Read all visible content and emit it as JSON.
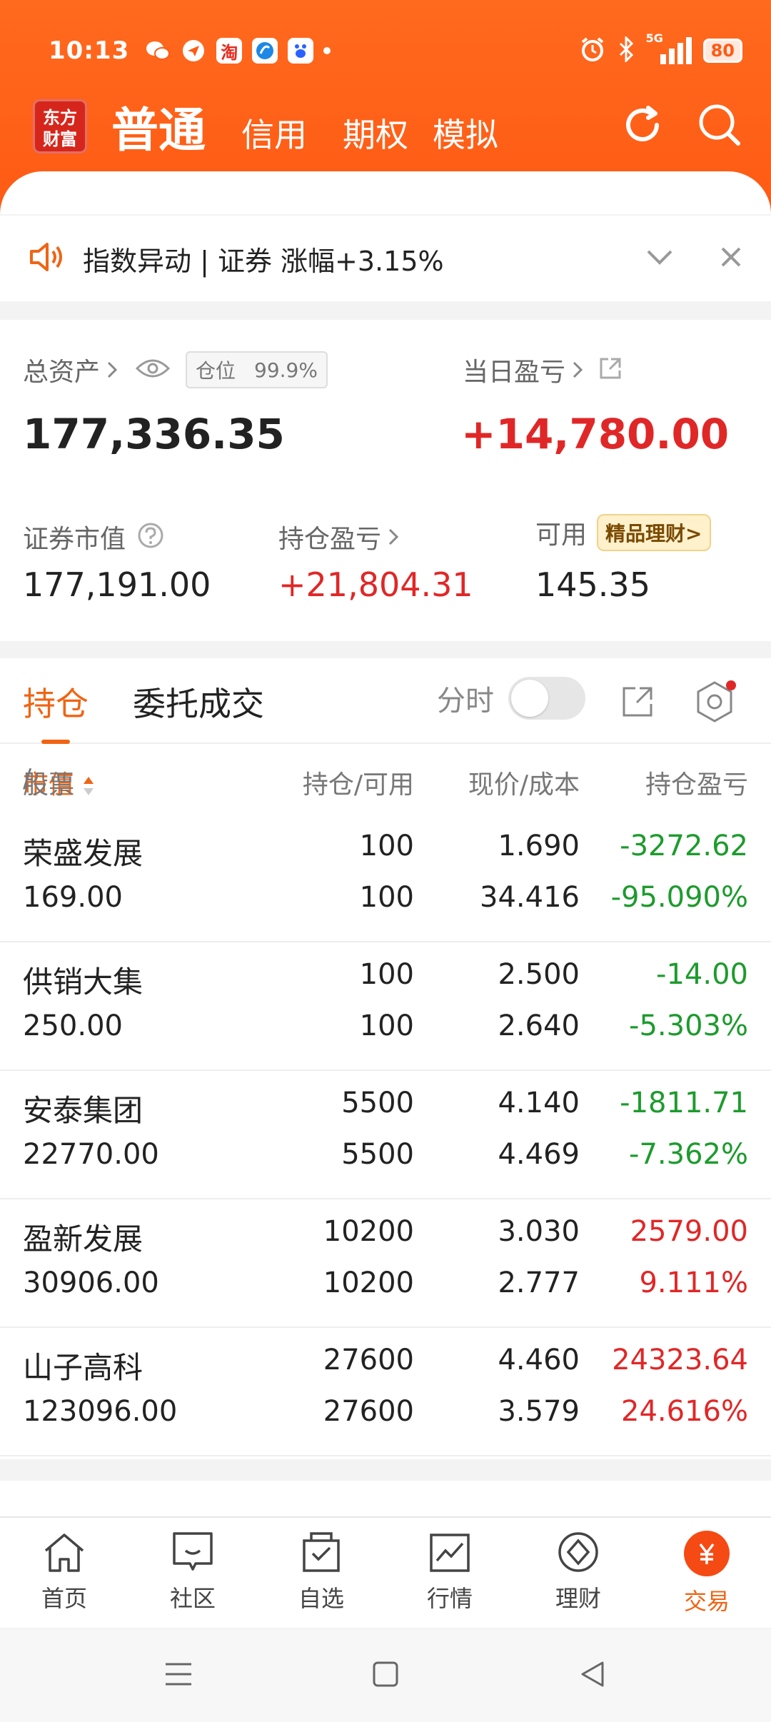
{
  "status_bar": {
    "time": "10:13",
    "network": "5G",
    "battery": "80"
  },
  "header": {
    "logo_line1": "东方",
    "logo_line2": "财富",
    "tabs": [
      "普通",
      "信用",
      "期权",
      "模拟"
    ]
  },
  "notice": {
    "text": "指数异动 | 证券 涨幅+3.15%"
  },
  "assets": {
    "total_label": "总资产",
    "position_label": "仓位",
    "position_value": "99.9%",
    "total_value": "177,336.35",
    "daily_pl_label": "当日盈亏",
    "daily_pl_value": "+14,780.00",
    "market_value_label": "证券市值",
    "market_value": "177,191.00",
    "holding_pl_label": "持仓盈亏",
    "holding_pl_value": "+21,804.31",
    "available_label": "可用",
    "available_value": "145.35",
    "badge": "精品理财"
  },
  "holdings": {
    "tab_positions": "持仓",
    "tab_orders": "委托成交",
    "toggle_label": "分时",
    "headers": {
      "stock": "股票",
      "sep": "/",
      "market_value": "市值",
      "qty": "持仓/可用",
      "price": "现价/成本",
      "pl": "持仓盈亏"
    },
    "rows": [
      {
        "name": "荣盛发展",
        "value": "169.00",
        "qty": "100",
        "avail": "100",
        "price": "1.690",
        "cost": "34.416",
        "pl": "-3272.62",
        "pl_pct": "-95.090%",
        "dir": "down"
      },
      {
        "name": "供销大集",
        "value": "250.00",
        "qty": "100",
        "avail": "100",
        "price": "2.500",
        "cost": "2.640",
        "pl": "-14.00",
        "pl_pct": "-5.303%",
        "dir": "down"
      },
      {
        "name": "安泰集团",
        "value": "22770.00",
        "qty": "5500",
        "avail": "5500",
        "price": "4.140",
        "cost": "4.469",
        "pl": "-1811.71",
        "pl_pct": "-7.362%",
        "dir": "down"
      },
      {
        "name": "盈新发展",
        "value": "30906.00",
        "qty": "10200",
        "avail": "10200",
        "price": "3.030",
        "cost": "2.777",
        "pl": "2579.00",
        "pl_pct": "9.111%",
        "dir": "up"
      },
      {
        "name": "山子高科",
        "value": "123096.00",
        "qty": "27600",
        "avail": "27600",
        "price": "4.460",
        "cost": "3.579",
        "pl": "24323.64",
        "pl_pct": "24.616%",
        "dir": "up"
      }
    ]
  },
  "bottom_nav": [
    {
      "label": "首页",
      "icon": "home-icon"
    },
    {
      "label": "社区",
      "icon": "chat-icon"
    },
    {
      "label": "自选",
      "icon": "favorites-icon"
    },
    {
      "label": "行情",
      "icon": "market-chart-icon"
    },
    {
      "label": "理财",
      "icon": "wealth-diamond-icon"
    },
    {
      "label": "交易",
      "icon": "trade-yuan-icon"
    }
  ],
  "colors": {
    "brand": "#ff5a14",
    "up": "#e02727",
    "down": "#1d9b2d",
    "accent": "#f06414"
  }
}
